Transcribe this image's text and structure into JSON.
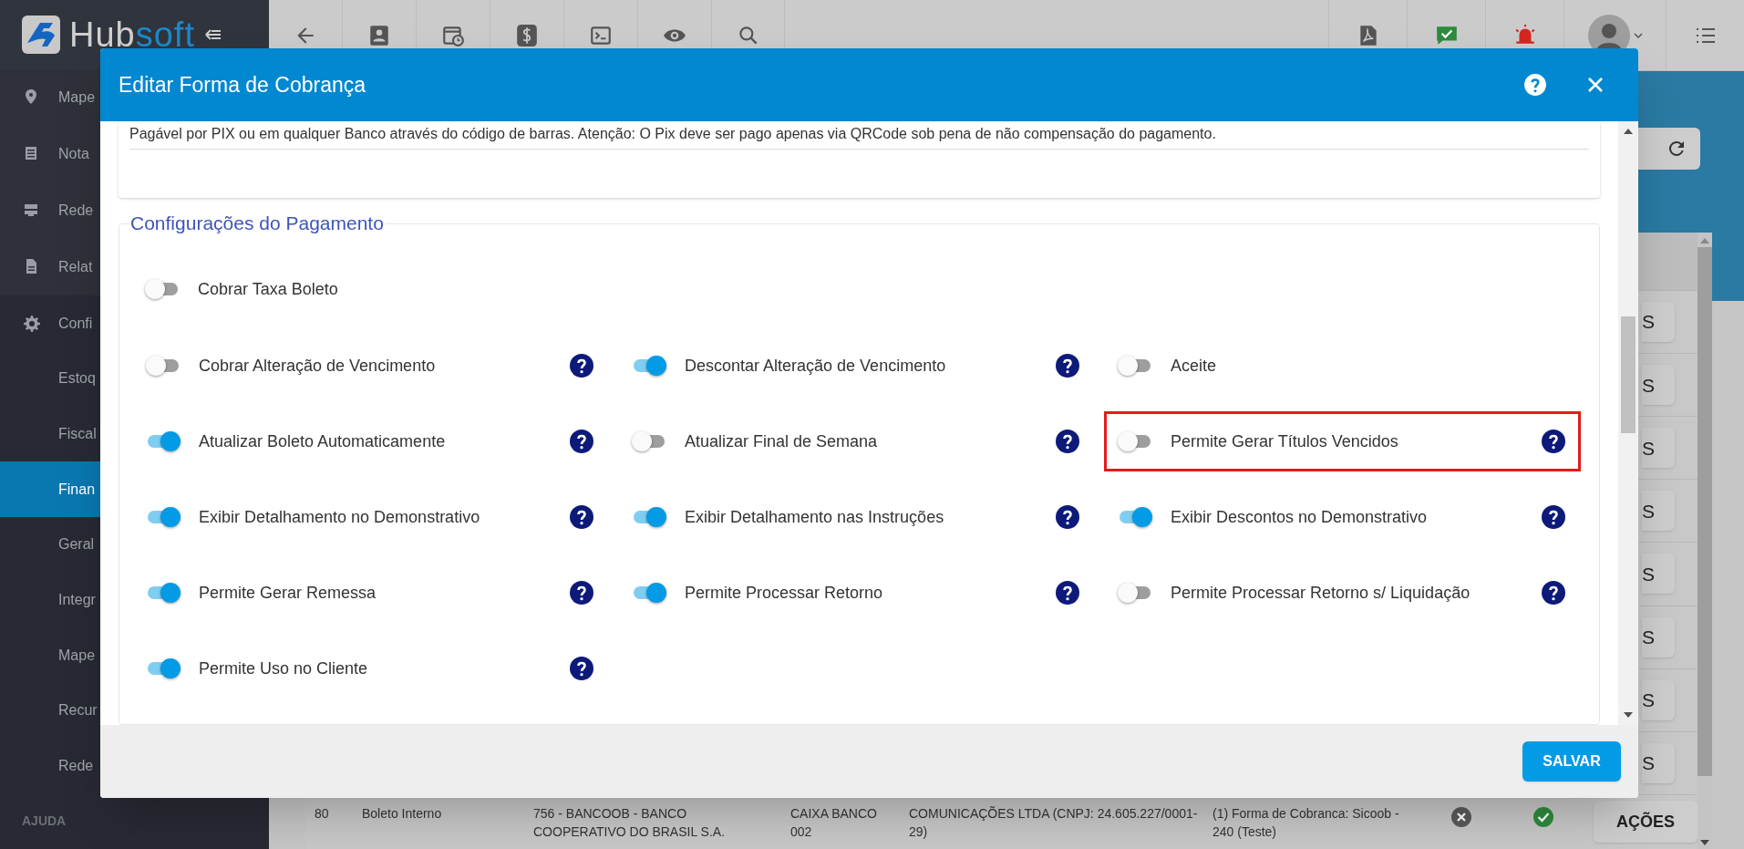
{
  "sidebar": {
    "logo": [
      "Hub",
      "soft"
    ],
    "items": [
      {
        "label": "Mape",
        "selected": false
      },
      {
        "label": "Nota",
        "selected": false
      },
      {
        "label": "Rede",
        "selected": false
      },
      {
        "label": "Relat",
        "selected": false
      },
      {
        "label": "Confi",
        "selected": false,
        "children": [
          {
            "label": "Estoq",
            "selected": false
          },
          {
            "label": "Fiscal",
            "selected": false
          },
          {
            "label": "Finan",
            "selected": true
          },
          {
            "label": "Geral",
            "selected": false
          },
          {
            "label": "Integr",
            "selected": false
          },
          {
            "label": "Mape",
            "selected": false
          },
          {
            "label": "Recur",
            "selected": false
          },
          {
            "label": "Rede",
            "selected": false
          }
        ]
      }
    ],
    "section": "AJUDA"
  },
  "table": {
    "row_buttons": [
      "S",
      "S",
      "S",
      "S",
      "S",
      "S",
      "S",
      "S"
    ],
    "last_row": {
      "cells": [
        "80",
        "Boleto Interno",
        "756 - BANCOOB - BANCO COOPERATIVO DO BRASIL S.A.",
        "CAIXA BANCO 002",
        "COMUNICAÇÕES LTDA (CNPJ: 24.605.227/0001-29)",
        "(1) Forma de Cobranca: Sicoob - 240 (Teste)"
      ],
      "active": false,
      "valid": true,
      "button": "AÇÕES"
    }
  },
  "modal": {
    "title": "Editar Forma de Cobrança",
    "description": "Pagável por PIX ou em qualquer Banco através do código de barras. Atenção: O Pix deve ser pago apenas via QRCode sob pena de não compensação do pagamento.",
    "section_title": "Configurações do Pagamento",
    "first_option": {
      "label": "Cobrar Taxa Boleto",
      "on": false
    },
    "options": [
      {
        "label": "Cobrar Alteração de Vencimento",
        "on": false,
        "help": true,
        "highlighted": false
      },
      {
        "label": "Descontar Alteração de Vencimento",
        "on": true,
        "help": true,
        "highlighted": false
      },
      {
        "label": "Aceite",
        "on": false,
        "help": false,
        "highlighted": false
      },
      {
        "label": "Atualizar Boleto Automaticamente",
        "on": true,
        "help": true,
        "highlighted": false
      },
      {
        "label": "Atualizar Final de Semana",
        "on": false,
        "help": true,
        "highlighted": false
      },
      {
        "label": "Permite Gerar Títulos Vencidos",
        "on": false,
        "help": true,
        "highlighted": true
      },
      {
        "label": "Exibir Detalhamento no Demonstrativo",
        "on": true,
        "help": true,
        "highlighted": false
      },
      {
        "label": "Exibir Detalhamento nas Instruções",
        "on": true,
        "help": true,
        "highlighted": false
      },
      {
        "label": "Exibir Descontos no Demonstrativo",
        "on": true,
        "help": true,
        "highlighted": false
      },
      {
        "label": "Permite Gerar Remessa",
        "on": true,
        "help": true,
        "highlighted": false
      },
      {
        "label": "Permite Processar Retorno",
        "on": true,
        "help": true,
        "highlighted": false
      },
      {
        "label": "Permite Processar Retorno s/ Liquidação",
        "on": false,
        "help": true,
        "highlighted": false
      },
      {
        "label": "Permite Uso no Cliente",
        "on": true,
        "help": true,
        "highlighted": false
      }
    ],
    "save_button": "SALVAR"
  }
}
